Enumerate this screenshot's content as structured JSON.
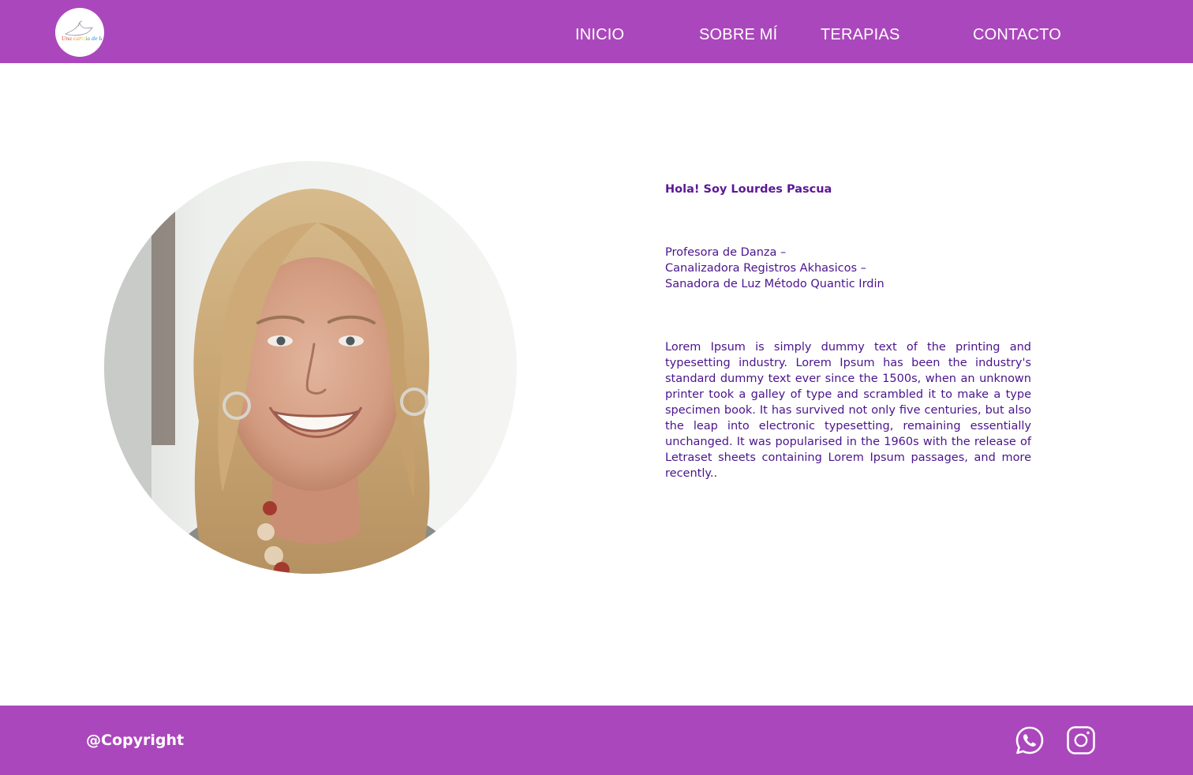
{
  "header": {
    "logo_text": "Una caricia de la luz",
    "nav": [
      {
        "label": "INICIO"
      },
      {
        "label": "SOBRE MÍ"
      },
      {
        "label": "TERAPIAS"
      },
      {
        "label": "CONTACTO"
      }
    ]
  },
  "main": {
    "greeting": "Hola! Soy Lourdes Pascua",
    "roles": [
      "Profesora de Danza –",
      "Canalizadora Registros Akhasicos –",
      "Sanadora de Luz Método Quantic Irdin"
    ],
    "bio": "Lorem Ipsum is simply dummy text of the printing and typesetting industry. Lorem Ipsum has been the industry's standard dummy text ever since the 1500s, when an unknown printer took a galley of type and scrambled it to make a type specimen book. It has survived not only five centuries, but also the leap into electronic typesetting, remaining essentially unchanged. It was popularised in the 1960s with the release of Letraset sheets containing Lorem Ipsum passages, and more recently.."
  },
  "footer": {
    "copyright": "@Copyright",
    "social": [
      {
        "icon": "whatsapp-icon"
      },
      {
        "icon": "instagram-icon"
      }
    ]
  },
  "colors": {
    "brand": "#ab47bc",
    "text": "#4a148c",
    "white": "#ffffff"
  }
}
